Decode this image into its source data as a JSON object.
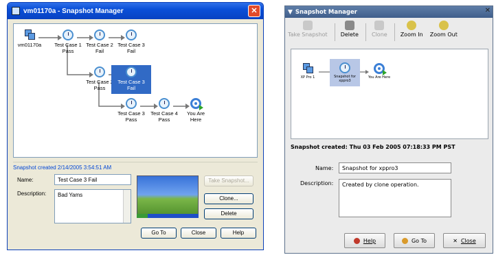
{
  "left_window": {
    "title": "vm01170a - Snapshot Manager",
    "close_glyph": "✕",
    "tree": {
      "nodes": [
        {
          "label": "vm01170a",
          "icon": "vm-icon"
        },
        {
          "label": "Test Case 1\nPass",
          "icon": "snapshot-icon"
        },
        {
          "label": "Test Case 2\nFail",
          "icon": "snapshot-icon"
        },
        {
          "label": "Test Case 3\nFail",
          "icon": "snapshot-icon"
        },
        {
          "label": "Test Case 2\nPass",
          "icon": "snapshot-icon"
        },
        {
          "label": "Test Case 3\nFail",
          "icon": "snapshot-icon",
          "selected": true
        },
        {
          "label": "Test Case 3\nPass",
          "icon": "snapshot-icon"
        },
        {
          "label": "Test Case 4\nPass",
          "icon": "snapshot-icon"
        },
        {
          "label": "You Are\nHere",
          "icon": "you-are-here-icon"
        }
      ]
    },
    "created": "Snapshot created 2/14/2005 3:54:51 AM",
    "name_label": "Name:",
    "name_value": "Test Case 3 Fail",
    "description_label": "Description:",
    "description_value": "Bad Yams",
    "take_snapshot": "Take Snapshot...",
    "clone": "Clone...",
    "delete": "Delete",
    "go_to": "Go To",
    "close": "Close",
    "help": "Help"
  },
  "right_window": {
    "title": "Snapshot Manager",
    "toolbar": [
      {
        "label": "Take Snapshot",
        "icon": "camera-icon",
        "enabled": false
      },
      {
        "label": "Delete",
        "icon": "trash-icon",
        "enabled": true
      },
      {
        "label": "Clone",
        "icon": "clone-icon",
        "enabled": false
      },
      {
        "label": "Zoom In",
        "icon": "zoom-in-icon",
        "enabled": true
      },
      {
        "label": "Zoom Out",
        "icon": "zoom-out-icon",
        "enabled": true
      }
    ],
    "tree": {
      "nodes": [
        {
          "label": "XP Pro 1",
          "icon": "vm-icon"
        },
        {
          "label": "Snapshot for\nxppro3",
          "icon": "snapshot-icon",
          "selected": true
        },
        {
          "label": "You Are Here",
          "icon": "you-are-here-icon"
        }
      ]
    },
    "created": "Snapshot created: Thu 03 Feb 2005 07:18:33 PM PST",
    "name_label": "Name:",
    "name_value": "Snapshot for xppro3",
    "description_label": "Description:",
    "description_value": "Created by clone operation.",
    "help": "Help",
    "go_to": "Go To",
    "close": "Close"
  },
  "colors": {
    "xp_blue": "#0a4fd8",
    "selection": "#316ac5",
    "gnome_title": "#4f6e99"
  }
}
